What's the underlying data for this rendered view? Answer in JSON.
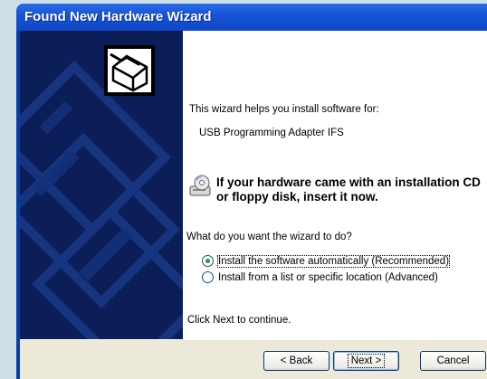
{
  "window": {
    "title": "Found New Hardware Wizard"
  },
  "content": {
    "intro": "This wizard helps you install software for:",
    "device_name": "USB Programming Adapter IFS",
    "cd_prompt_line1": "If your hardware came with an installation CD",
    "cd_prompt_line2": "or floppy disk, insert it now.",
    "question": "What do you want the wizard to do?",
    "options": [
      {
        "label": "Install the software automatically (Recommended)",
        "selected": true
      },
      {
        "label": "Install from a list or specific location (Advanced)",
        "selected": false
      }
    ],
    "continue_hint": "Click Next to continue."
  },
  "buttons": {
    "back": "< Back",
    "next": "Next >",
    "cancel": "Cancel"
  },
  "icons": {
    "side": "hardware-wizard-icon",
    "cd": "cd-drive-icon"
  },
  "colors": {
    "title_bar": "#1654d6",
    "side_panel": "#0c1e57",
    "radio_selected": "#21a121"
  }
}
